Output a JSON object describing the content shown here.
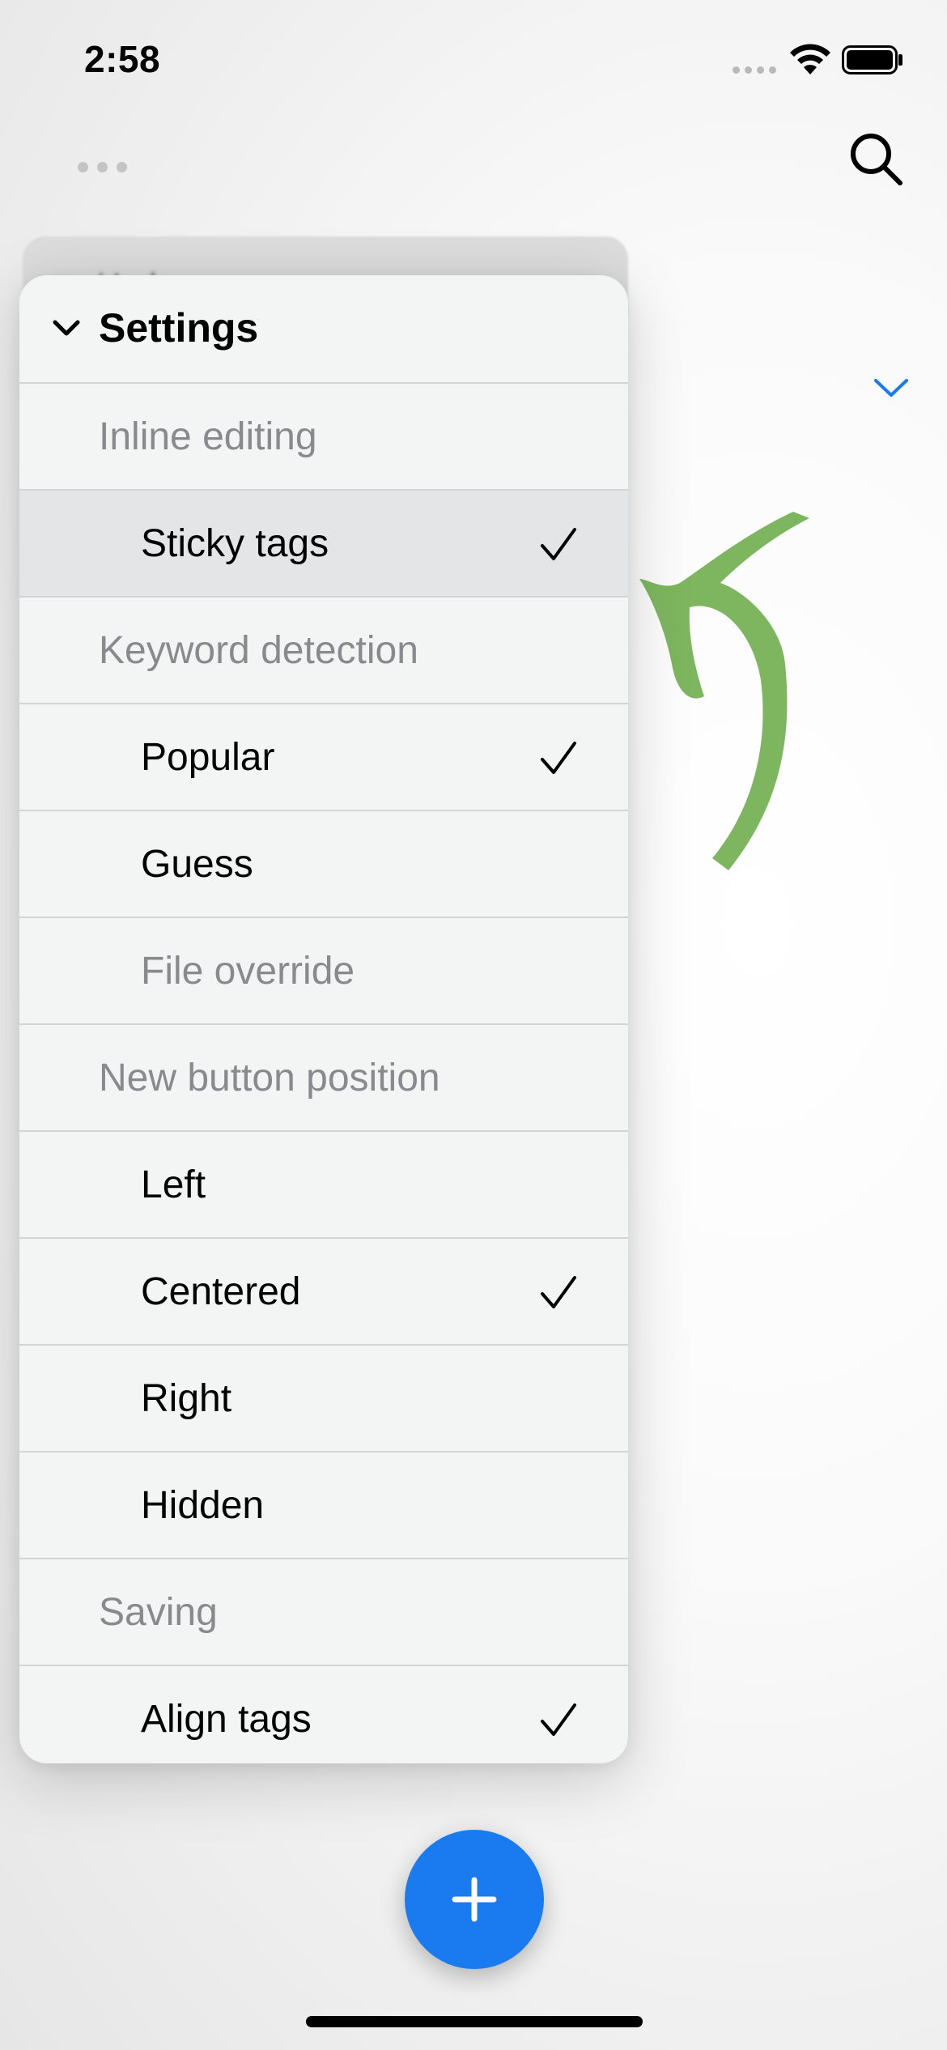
{
  "status_bar": {
    "time": "2:58"
  },
  "underlying_row": {
    "label": "Undo"
  },
  "menu": {
    "title": "Settings",
    "rows": [
      {
        "type": "section",
        "label": "Inline editing"
      },
      {
        "type": "option",
        "label": "Sticky tags",
        "checked": true,
        "highlighted": true
      },
      {
        "type": "section",
        "label": "Keyword detection"
      },
      {
        "type": "option",
        "label": "Popular",
        "checked": true
      },
      {
        "type": "option",
        "label": "Guess",
        "checked": false
      },
      {
        "type": "option",
        "label": "File override",
        "checked": false,
        "disabled": true
      },
      {
        "type": "section",
        "label": "New button position"
      },
      {
        "type": "option",
        "label": "Left",
        "checked": false
      },
      {
        "type": "option",
        "label": "Centered",
        "checked": true
      },
      {
        "type": "option",
        "label": "Right",
        "checked": false
      },
      {
        "type": "option",
        "label": "Hidden",
        "checked": false
      },
      {
        "type": "section",
        "label": "Saving"
      },
      {
        "type": "option",
        "label": "Align tags",
        "checked": true
      }
    ]
  },
  "colors": {
    "accent": "#1a7bf0",
    "doodle": "#6fae4e"
  },
  "icons": {
    "more": "ellipsis-icon",
    "search": "magnifying-glass-icon",
    "collapse": "chevron-down-icon",
    "add": "plus-icon"
  }
}
